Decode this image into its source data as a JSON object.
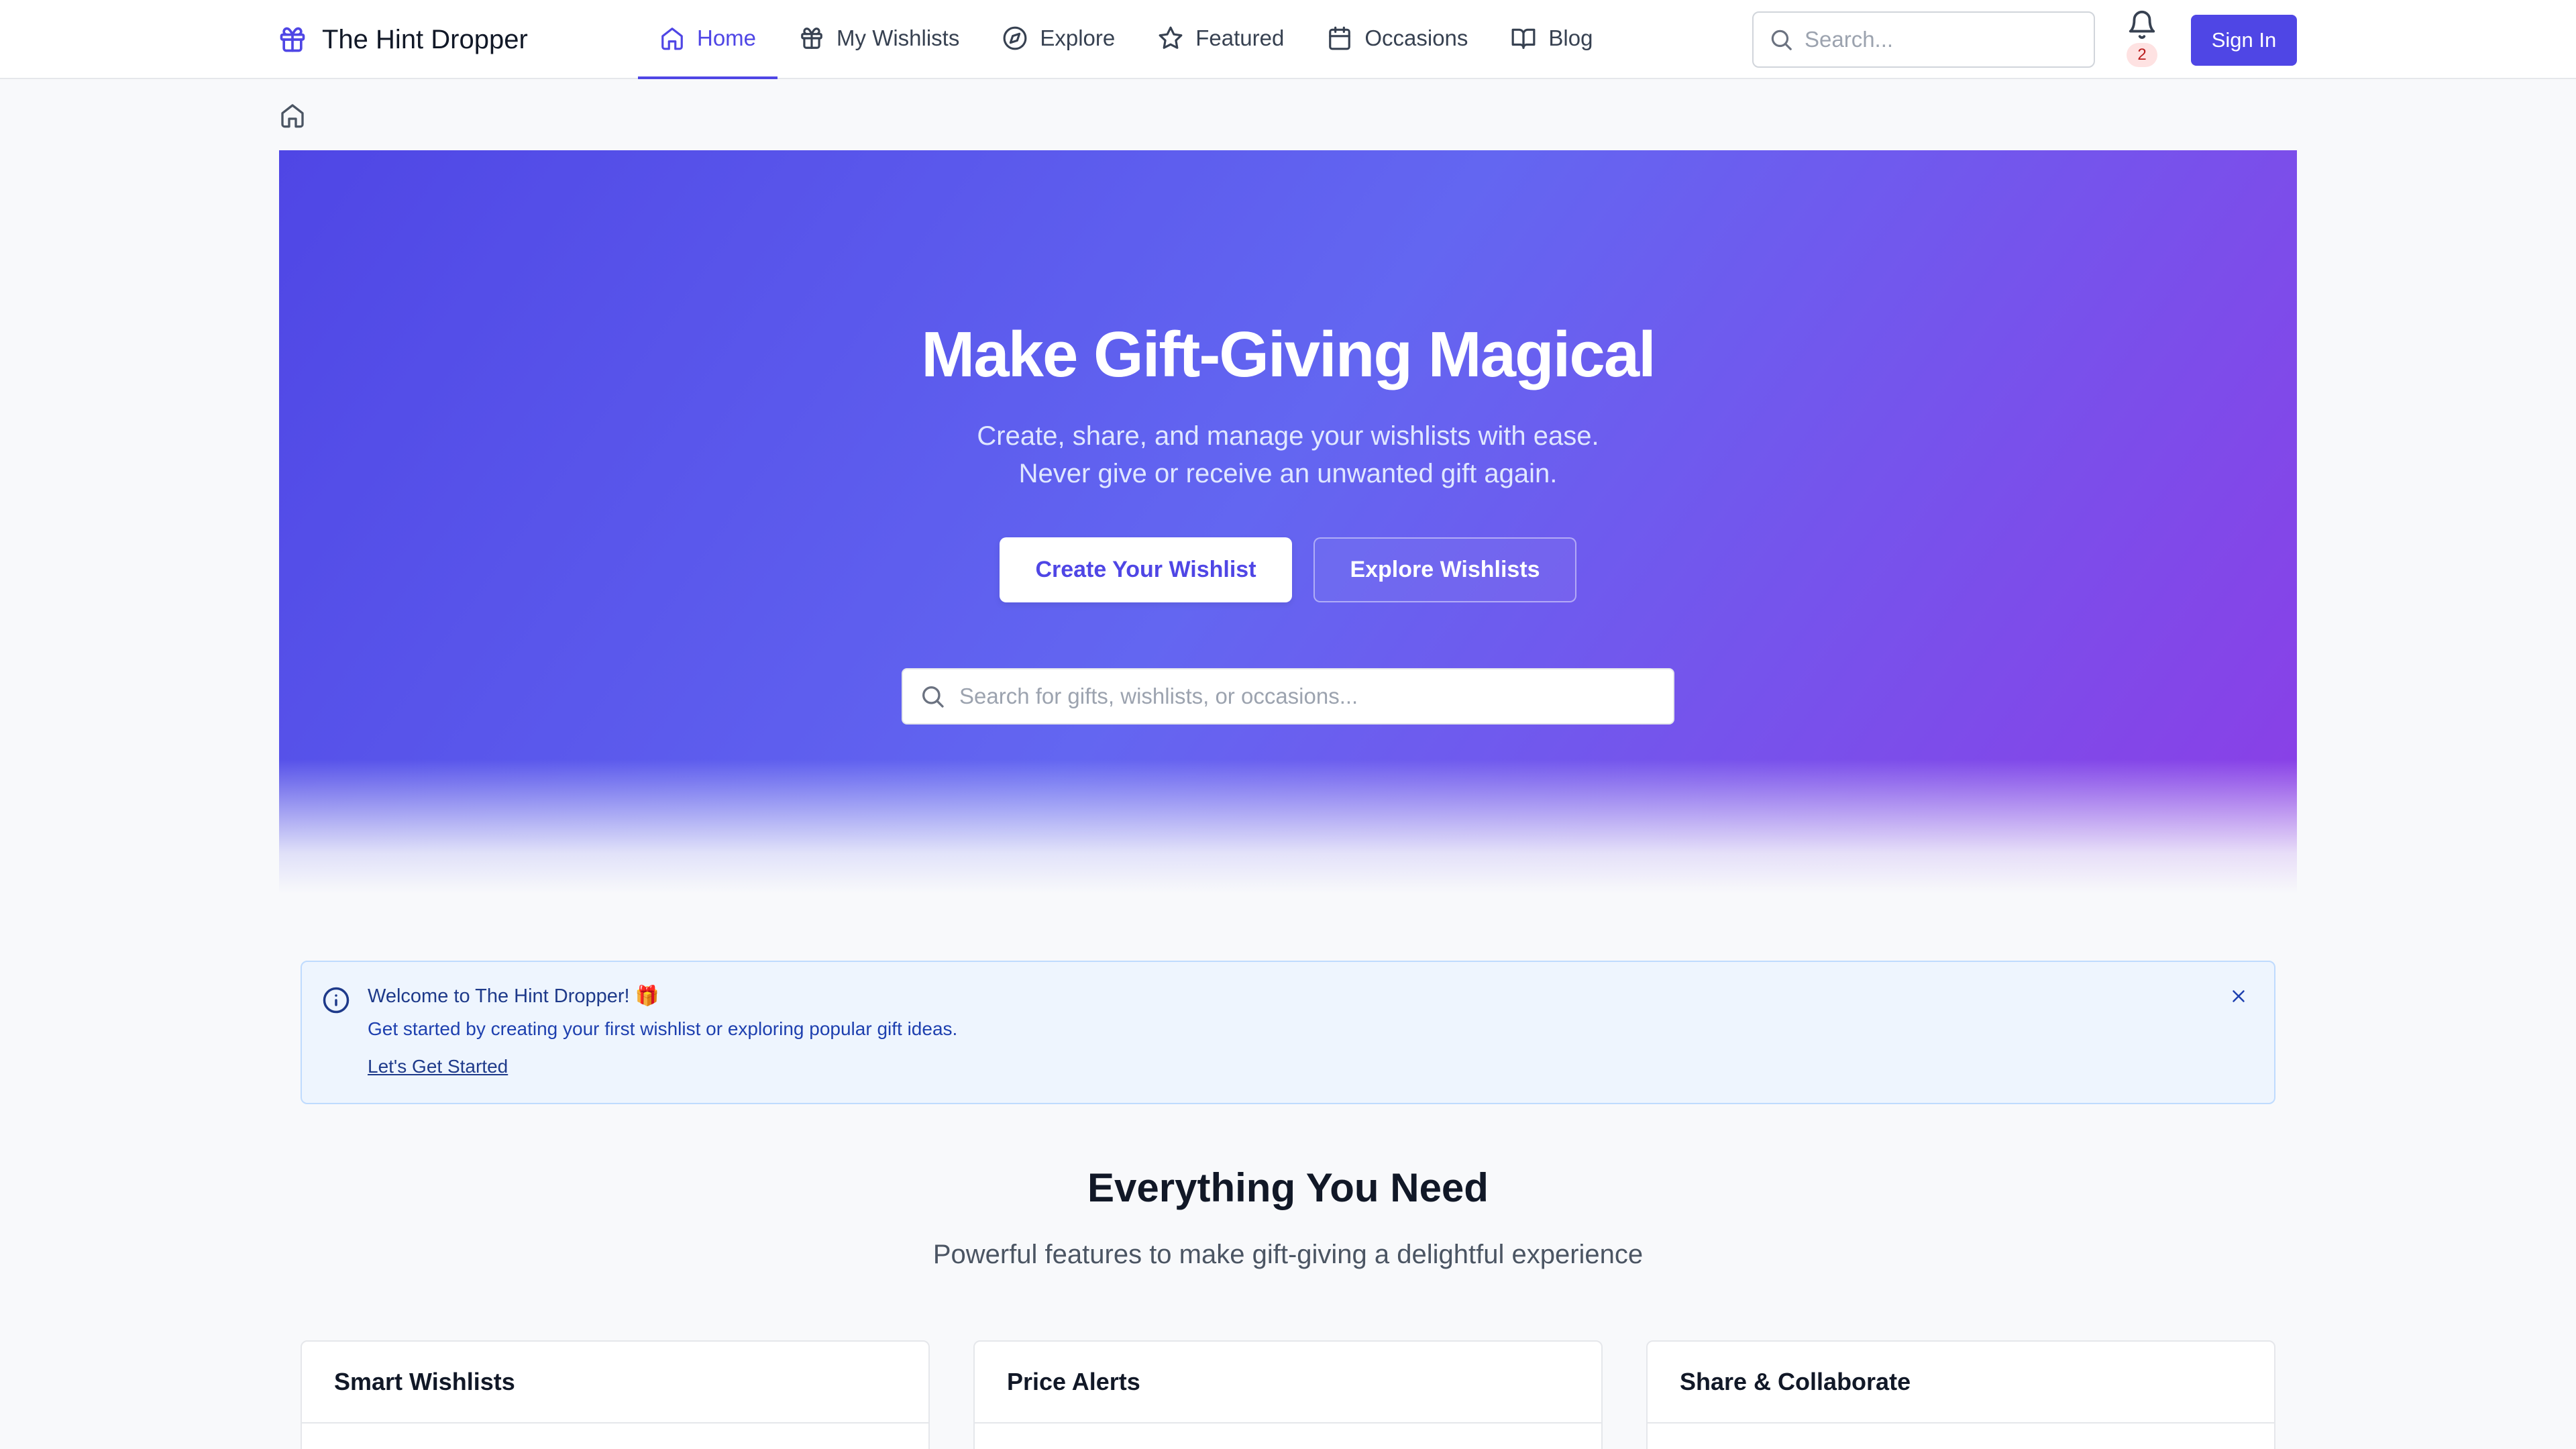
{
  "brand": {
    "name": "The Hint Dropper"
  },
  "nav": {
    "items": [
      {
        "label": "Home",
        "icon": "home-icon",
        "active": true
      },
      {
        "label": "My Wishlists",
        "icon": "gift-icon"
      },
      {
        "label": "Explore",
        "icon": "compass-icon"
      },
      {
        "label": "Featured",
        "icon": "star-icon"
      },
      {
        "label": "Occasions",
        "icon": "calendar-icon"
      },
      {
        "label": "Blog",
        "icon": "book-icon"
      }
    ]
  },
  "header": {
    "search_placeholder": "Search...",
    "notification_count": "2",
    "signin_label": "Sign In"
  },
  "hero": {
    "title": "Make Gift-Giving Magical",
    "subtitle": "Create, share, and manage your wishlists with ease. Never give or receive an unwanted gift again.",
    "primary_cta": "Create Your Wishlist",
    "secondary_cta": "Explore Wishlists",
    "search_placeholder": "Search for gifts, wishlists, or occasions..."
  },
  "alert": {
    "title": "Welcome to The Hint Dropper! 🎁",
    "body": "Get started by creating your first wishlist or exploring popular gift ideas.",
    "link": "Let's Get Started"
  },
  "features": {
    "title": "Everything You Need",
    "subtitle": "Powerful features to make gift-giving a delightful experience",
    "cards": [
      {
        "title": "Smart Wishlists"
      },
      {
        "title": "Price Alerts"
      },
      {
        "title": "Share & Collaborate"
      }
    ]
  },
  "colors": {
    "accent": "#4f46e5",
    "hero_gradient_start": "#4f46e5",
    "hero_gradient_end": "#8b3ee6",
    "alert_bg": "#eef5fe"
  }
}
